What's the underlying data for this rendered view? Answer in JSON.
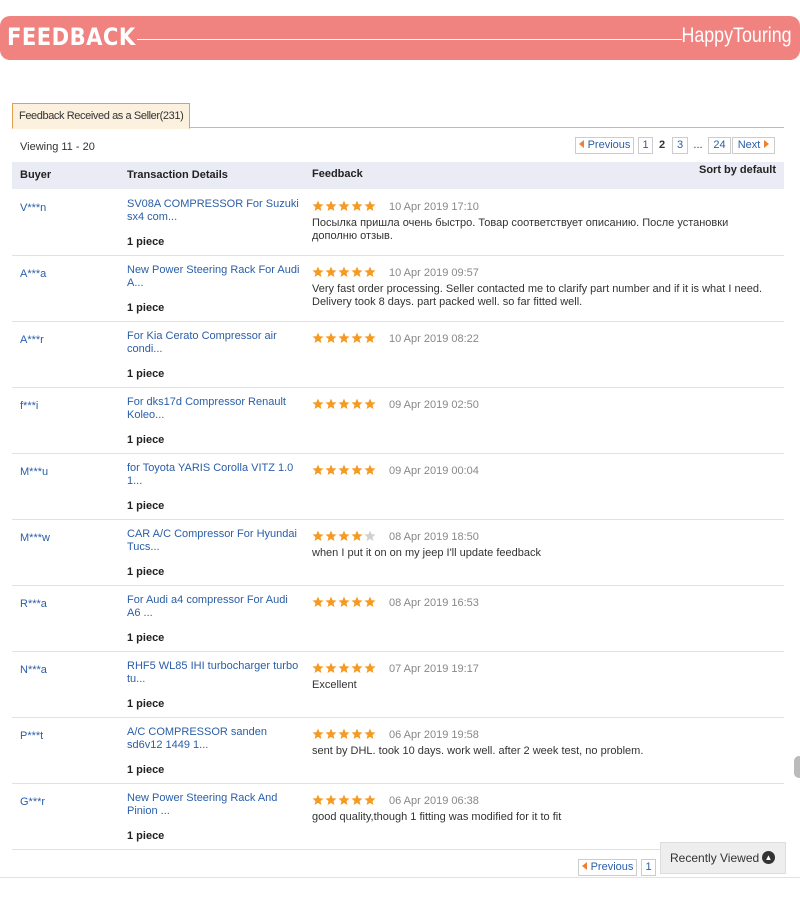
{
  "banner": {
    "title": "FEEDBACK",
    "store": "HappyTouring"
  },
  "tab": {
    "label": "Feedback Received as a Seller(231)"
  },
  "viewing": "Viewing 11 - 20",
  "pager": {
    "previous": "Previous",
    "pages": [
      "1",
      "2",
      "3"
    ],
    "current": "2",
    "dots": "...",
    "last": "24",
    "next": "Next"
  },
  "table": {
    "headers": {
      "buyer": "Buyer",
      "transaction": "Transaction Details",
      "feedback": "Feedback",
      "sort": "Sort by default"
    }
  },
  "rows": [
    {
      "buyer": "V***n",
      "product": "SV08A COMPRESSOR For Suzuki sx4 com...",
      "quantity": "1 piece",
      "stars": 5,
      "date": "10 Apr 2019 17:10",
      "comment": "Посылка пришла очень быстро. Товар соответствует описанию. После установки дополню отзыв."
    },
    {
      "buyer": "A***a",
      "product": "New Power Steering Rack For Audi A...",
      "quantity": "1 piece",
      "stars": 5,
      "date": "10 Apr 2019 09:57",
      "comment": "Very fast order processing. Seller contacted me to clarify part number and if it is what I need. Delivery took 8 days. part packed well. so far fitted well."
    },
    {
      "buyer": "A***r",
      "product": "For Kia Cerato Compressor air condi...",
      "quantity": "1 piece",
      "stars": 5,
      "date": "10 Apr 2019 08:22",
      "comment": ""
    },
    {
      "buyer": "f***i",
      "product": "For dks17d Compressor Renault Koleo...",
      "quantity": "1 piece",
      "stars": 5,
      "date": "09 Apr 2019 02:50",
      "comment": ""
    },
    {
      "buyer": "M***u",
      "product": "for Toyota YARIS Corolla VITZ 1.0 1...",
      "quantity": "1 piece",
      "stars": 5,
      "date": "09 Apr 2019 00:04",
      "comment": ""
    },
    {
      "buyer": "M***w",
      "product": "CAR A/C Compressor For Hyundai Tucs...",
      "quantity": "1 piece",
      "stars": 4,
      "date": "08 Apr 2019 18:50",
      "comment": "when I put it on on my jeep I'll update feedback"
    },
    {
      "buyer": "R***a",
      "product": "For Audi a4 compressor For Audi A6 ...",
      "quantity": "1 piece",
      "stars": 5,
      "date": "08 Apr 2019 16:53",
      "comment": ""
    },
    {
      "buyer": "N***a",
      "product": "RHF5 WL85 IHI turbocharger turbo tu...",
      "quantity": "1 piece",
      "stars": 5,
      "date": "07 Apr 2019 19:17",
      "comment": "Excellent"
    },
    {
      "buyer": "P***t",
      "product": "A/C COMPRESSOR sanden sd6v12 1449 1...",
      "quantity": "1 piece",
      "stars": 5,
      "date": "06 Apr 2019 19:58",
      "comment": "sent by DHL. took 10 days. work well. after 2 week test, no problem."
    },
    {
      "buyer": "G***r",
      "product": "New Power Steering Rack And Pinion ...",
      "quantity": "1 piece",
      "stars": 5,
      "date": "06 Apr 2019 06:38",
      "comment": "good quality,though 1 fitting was modified for it to fit"
    }
  ],
  "bottom_pager": {
    "previous": "Previous",
    "first": "1"
  },
  "recently_viewed": {
    "label": "Recently Viewed"
  },
  "colors": {
    "banner": "#f08280",
    "link": "#2a5ea8",
    "star_filled": "#f59a22",
    "star_empty": "#d0d0d0",
    "header_bg": "#e9ecf4"
  }
}
